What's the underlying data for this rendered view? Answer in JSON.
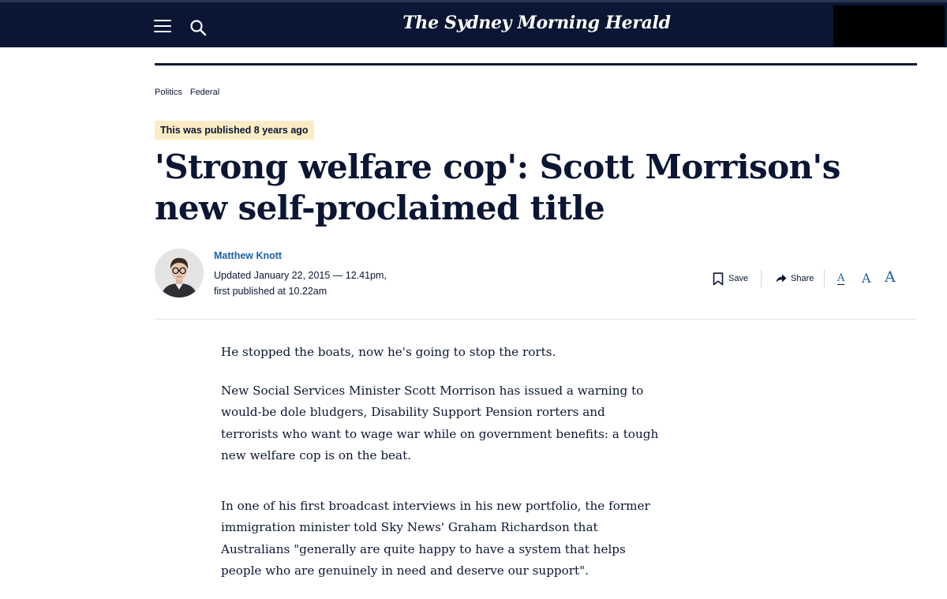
{
  "header": {
    "masthead": "The Sydney Morning Herald",
    "menu_icon": "hamburger-menu-icon",
    "search_icon": "search-icon",
    "background": "#0a1633"
  },
  "breadcrumb": [
    "Politics",
    "Federal"
  ],
  "badge": "This was published 8 years ago",
  "headline": "'Strong welfare cop': Scott Morrison's new self-proclaimed title",
  "byline": {
    "author": "Matthew Knott",
    "dateline": "Updated January 22, 2015 — 12.41pm, first published at 10.22am"
  },
  "tools": {
    "save_label": "Save",
    "share_label": "Share",
    "font_sizes": [
      "A",
      "A",
      "A"
    ]
  },
  "body": [
    "He stopped the boats, now he's going to stop the rorts.",
    "New Social Services Minister Scott Morrison has issued a warning to would-be dole bludgers, Disability Support Pension rorters and terrorists who want to wage war while on government benefits: a tough new welfare cop is on the beat.",
    "In one of his first broadcast interviews in his new portfolio, the former immigration minister told Sky News' Graham Richardson that Australians \"generally are quite happy to have a system that helps people who are genuinely in need and deserve our support\"."
  ],
  "colors": {
    "navy": "#0a1633",
    "link_blue": "#1d5ea8",
    "badge_bg": "#fbecc5"
  }
}
